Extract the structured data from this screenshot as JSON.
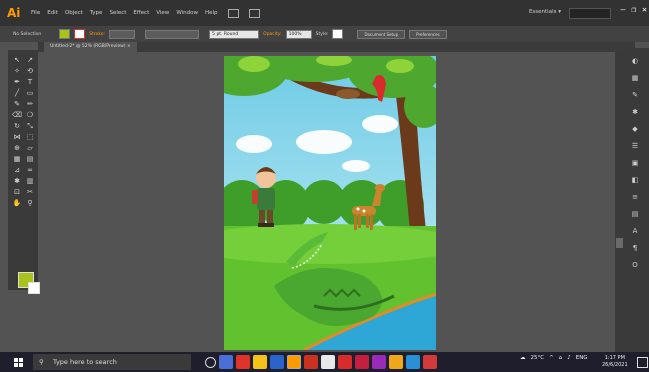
{
  "app": {
    "logo": "Ai",
    "essentials": "Essentials",
    "workspace_arrow": "▾"
  },
  "menu": [
    "File",
    "Edit",
    "Object",
    "Type",
    "Select",
    "Effect",
    "View",
    "Window",
    "Help"
  ],
  "window_controls": {
    "minimize": "–",
    "restore": "❐",
    "close": "✕"
  },
  "controlbar": {
    "selection": "No Selection",
    "stroke_label": "Stroke:",
    "brush": "5 pt. Round",
    "opacity_label": "Opacity:",
    "opacity_value": "100%",
    "style_label": "Style:",
    "document_setup": "Document Setup",
    "preferences": "Preferences",
    "fill_color": "#a9c31b",
    "stroke_color": "#d83030"
  },
  "tab": {
    "title": "Untitled-2* @ 52% (RGB/Preview)",
    "close": "×"
  },
  "tools": [
    {
      "icon": "selection-icon",
      "glyph": "↖"
    },
    {
      "icon": "direct-selection-icon",
      "glyph": "↗"
    },
    {
      "icon": "magic-wand-icon",
      "glyph": "✧"
    },
    {
      "icon": "lasso-icon",
      "glyph": "⟲"
    },
    {
      "icon": "pen-icon",
      "glyph": "✒"
    },
    {
      "icon": "type-icon",
      "glyph": "T"
    },
    {
      "icon": "line-icon",
      "glyph": "╱"
    },
    {
      "icon": "rectangle-icon",
      "glyph": "▭"
    },
    {
      "icon": "paintbrush-icon",
      "glyph": "✎"
    },
    {
      "icon": "pencil-icon",
      "glyph": "✏"
    },
    {
      "icon": "eraser-icon",
      "glyph": "⌫"
    },
    {
      "icon": "blob-brush-icon",
      "glyph": "❍"
    },
    {
      "icon": "rotate-icon",
      "glyph": "↻"
    },
    {
      "icon": "scale-icon",
      "glyph": "⤡"
    },
    {
      "icon": "width-icon",
      "glyph": "⋈"
    },
    {
      "icon": "free-transform-icon",
      "glyph": "⬚"
    },
    {
      "icon": "shape-builder-icon",
      "glyph": "⊕"
    },
    {
      "icon": "perspective-icon",
      "glyph": "▱"
    },
    {
      "icon": "mesh-icon",
      "glyph": "▦"
    },
    {
      "icon": "gradient-icon",
      "glyph": "▤"
    },
    {
      "icon": "eyedropper-icon",
      "glyph": "⊿"
    },
    {
      "icon": "blend-icon",
      "glyph": "∞"
    },
    {
      "icon": "symbol-sprayer-icon",
      "glyph": "✱"
    },
    {
      "icon": "column-graph-icon",
      "glyph": "▥"
    },
    {
      "icon": "artboard-icon",
      "glyph": "⊡"
    },
    {
      "icon": "slice-icon",
      "glyph": "✂"
    },
    {
      "icon": "hand-icon",
      "glyph": "✋"
    },
    {
      "icon": "zoom-icon",
      "glyph": "⚲"
    }
  ],
  "right_panel_icons": [
    "color-icon",
    "swatches-icon",
    "brushes-icon",
    "symbols-icon",
    "graphic-styles-icon",
    "align-icon",
    "transform-icon",
    "pathfinder-icon",
    "stroke-icon",
    "gradient-panel-icon",
    "character-icon",
    "paragraph-icon",
    "opentype-icon"
  ],
  "taskbar": {
    "search_placeholder": "Type here to search",
    "weather": "25°C",
    "language": "ENG",
    "time": "1:17 PM",
    "date": "26/6/2021"
  }
}
